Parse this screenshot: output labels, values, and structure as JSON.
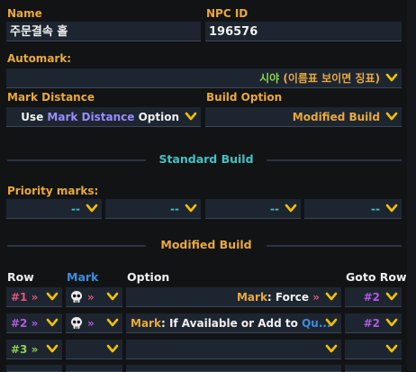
{
  "labels": {
    "name": "Name",
    "npc_id": "NPC ID",
    "automark": "Automark:",
    "mark_distance": "Mark Distance",
    "build_option": "Build Option",
    "priority_marks": "Priority marks:"
  },
  "fields": {
    "name_value": "주문결속 홀",
    "npc_id_value": "196576",
    "automark_value_a": "시야",
    "automark_value_b": "(이름표 보이면 징표)",
    "mark_distance": {
      "prefix": "Use",
      "highlight": "Mark Distance",
      "suffix": "Option"
    },
    "build_option_value": "Modified Build"
  },
  "sections": {
    "standard": "Standard Build",
    "modified": "Modified Build"
  },
  "priority_slots": [
    "--",
    "--",
    "--",
    "--"
  ],
  "columns": {
    "row": "Row",
    "mark": "Mark",
    "option": "Option",
    "goto": "Goto Row"
  },
  "rows": [
    {
      "row_label": "#1",
      "row_color": "#e0557a",
      "has_skull": true,
      "opt_a": "Mark",
      "opt_sep": ":",
      "opt_b": "Force",
      "opt_b_color": "#f0f0f0",
      "opt_arrow": "»",
      "goto": "#2",
      "goto_color": "#b05ae0"
    },
    {
      "row_label": "#2",
      "row_color": "#b05ae0",
      "has_skull": true,
      "opt_a": "Mark",
      "opt_sep": ":",
      "opt_b": "If Available or Add to",
      "opt_b_color": "#f0f0f0",
      "opt_tail": "Qu...",
      "opt_arrow": "",
      "goto": "#2",
      "goto_color": "#b05ae0"
    },
    {
      "row_label": "#3",
      "row_color": "#8fd14f",
      "has_skull": false,
      "opt_a": "",
      "opt_sep": "",
      "opt_b": "",
      "opt_arrow": "",
      "goto": "",
      "goto_color": "#f0f0f0"
    }
  ],
  "colors": {
    "accent_orange": "#e8a93a",
    "teal": "#3fc3c3",
    "mark_blue": "#3b8ee0",
    "highlight_purple": "#9a8cff",
    "chevron_yellow": "#f2c200"
  }
}
